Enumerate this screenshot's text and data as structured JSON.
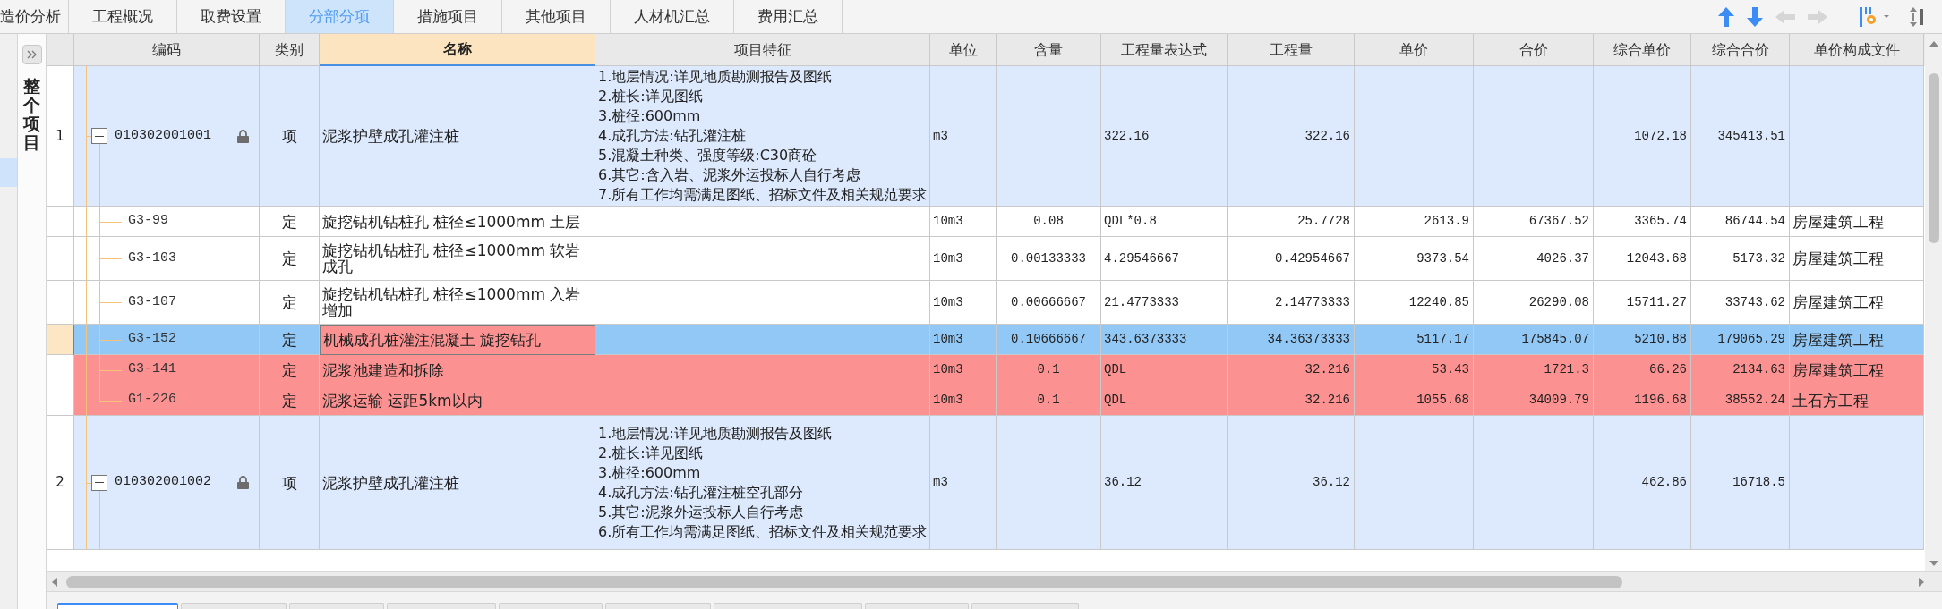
{
  "tabs": [
    {
      "label": "造价分析",
      "selected": false
    },
    {
      "label": "工程概况",
      "selected": false
    },
    {
      "label": "取费设置",
      "selected": false
    },
    {
      "label": "分部分项",
      "selected": true
    },
    {
      "label": "措施项目",
      "selected": false
    },
    {
      "label": "其他项目",
      "selected": false
    },
    {
      "label": "人材机汇总",
      "selected": false
    },
    {
      "label": "费用汇总",
      "selected": false
    }
  ],
  "toolbar": [
    {
      "kind": "up",
      "disabled": false
    },
    {
      "kind": "down",
      "disabled": false
    },
    {
      "kind": "left",
      "disabled": true
    },
    {
      "kind": "right",
      "disabled": true
    },
    {
      "kind": "columns",
      "disabled": false
    },
    {
      "kind": "sort",
      "disabled": false
    }
  ],
  "sidebar": {
    "title": "整个项目"
  },
  "table": {
    "columns": [
      {
        "label": "编码",
        "selected": false
      },
      {
        "label": "类别",
        "selected": false
      },
      {
        "label": "名称",
        "selected": true
      },
      {
        "label": "项目特征",
        "selected": false
      },
      {
        "label": "单位",
        "selected": false
      },
      {
        "label": "含量",
        "selected": false
      },
      {
        "label": "工程量表达式",
        "selected": false
      },
      {
        "label": "工程量",
        "selected": false
      },
      {
        "label": "单价",
        "selected": false
      },
      {
        "label": "合价",
        "selected": false
      },
      {
        "label": "综合单价",
        "selected": false
      },
      {
        "label": "综合合价",
        "selected": false
      },
      {
        "label": "单价构成文件",
        "selected": false
      }
    ],
    "rows": [
      {
        "kind": "item",
        "number": "1",
        "code": "010302001001",
        "locked": true,
        "expanded": true,
        "type": "项",
        "name": "泥浆护壁成孔灌注桩",
        "features": [
          "1.地层情况:详见地质勘测报告及图纸",
          "2.桩长:详见图纸",
          "3.桩径:600mm",
          "4.成孔方法:钻孔灌注桩",
          "5.混凝土种类、强度等级:C30商砼",
          "6.其它:含入岩、泥浆外运投标人自行考虑",
          "7.所有工作均需满足图纸、招标文件及相关规范要求"
        ],
        "unit": "m3",
        "quantity_expr": "322.16",
        "quantity": "322.16",
        "composite_unit_price": "1072.18",
        "composite_total": "345413.51",
        "children": [
          {
            "kind": "quota",
            "code": "G3-99",
            "type": "定",
            "name": "旋挖钻机钻桩孔 桩径≤1000mm 土层",
            "unit": "10m3",
            "content": "0.08",
            "quantity_expr": "QDL*0.8",
            "quantity": "25.7728",
            "unit_price": "2613.9",
            "total_price": "67367.52",
            "composite_unit_price": "3365.74",
            "composite_total": "86744.54",
            "price_file": "房屋建筑工程",
            "selected": false,
            "flagged": false
          },
          {
            "kind": "quota",
            "code": "G3-103",
            "type": "定",
            "name": "旋挖钻机钻桩孔 桩径≤1000mm 软岩成孔",
            "unit": "10m3",
            "content": "0.00133333",
            "quantity_expr": "4.29546667",
            "quantity": "0.42954667",
            "unit_price": "9373.54",
            "total_price": "4026.37",
            "composite_unit_price": "12043.68",
            "composite_total": "5173.32",
            "price_file": "房屋建筑工程",
            "selected": false,
            "flagged": false
          },
          {
            "kind": "quota",
            "code": "G3-107",
            "type": "定",
            "name": "旋挖钻机钻桩孔 桩径≤1000mm 入岩增加",
            "unit": "10m3",
            "content": "0.00666667",
            "quantity_expr": "21.4773333",
            "quantity": "2.14773333",
            "unit_price": "12240.85",
            "total_price": "26290.08",
            "composite_unit_price": "15711.27",
            "composite_total": "33743.62",
            "price_file": "房屋建筑工程",
            "selected": false,
            "flagged": false
          },
          {
            "kind": "quota",
            "code": "G3-152",
            "type": "定",
            "name": "机械成孔桩灌注混凝土 旋挖钻孔",
            "unit": "10m3",
            "content": "0.10666667",
            "quantity_expr": "343.6373333",
            "quantity": "34.36373333",
            "unit_price": "5117.17",
            "total_price": "175845.07",
            "composite_unit_price": "5210.88",
            "composite_total": "179065.29",
            "price_file": "房屋建筑工程",
            "selected": true,
            "flagged": true
          },
          {
            "kind": "quota",
            "code": "G3-141",
            "type": "定",
            "name": "泥浆池建造和拆除",
            "unit": "10m3",
            "content": "0.1",
            "quantity_expr": "QDL",
            "quantity": "32.216",
            "unit_price": "53.43",
            "total_price": "1721.3",
            "composite_unit_price": "66.26",
            "composite_total": "2134.63",
            "price_file": "房屋建筑工程",
            "selected": false,
            "flagged": true
          },
          {
            "kind": "quota",
            "code": "G1-226",
            "type": "定",
            "name": "泥浆运输 运距5km以内",
            "unit": "10m3",
            "content": "0.1",
            "quantity_expr": "QDL",
            "quantity": "32.216",
            "unit_price": "1055.68",
            "total_price": "34009.79",
            "composite_unit_price": "1196.68",
            "composite_total": "38552.24",
            "price_file": "土石方工程",
            "selected": false,
            "flagged": true
          }
        ]
      },
      {
        "kind": "item",
        "number": "2",
        "code": "010302001002",
        "locked": true,
        "expanded": true,
        "type": "项",
        "name": "泥浆护壁成孔灌注桩",
        "features": [
          "1.地层情况:详见地质勘测报告及图纸",
          "2.桩长:详见图纸",
          "3.桩径:600mm",
          "4.成孔方法:钻孔灌注桩空孔部分",
          "5.其它:泥浆外运投标人自行考虑",
          "6.所有工作均需满足图纸、招标文件及相关规范要求"
        ],
        "unit": "m3",
        "quantity_expr": "36.12",
        "quantity": "36.12",
        "composite_unit_price": "462.86",
        "composite_total": "16718.5",
        "children": []
      }
    ]
  },
  "bottom_tabs": [
    {
      "selected": true
    },
    {
      "selected": false
    },
    {
      "selected": false
    },
    {
      "selected": false
    },
    {
      "selected": false
    },
    {
      "selected": false
    },
    {
      "selected": false
    },
    {
      "selected": false
    },
    {
      "selected": false
    }
  ]
}
